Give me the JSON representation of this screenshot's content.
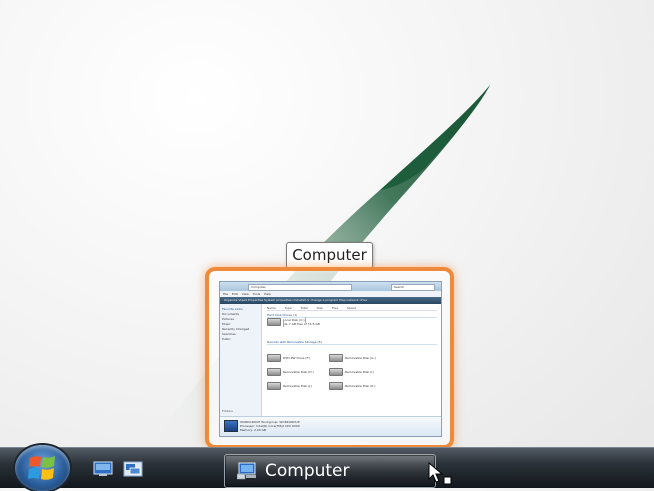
{
  "tooltip": {
    "title": "Computer"
  },
  "thumbnail": {
    "title_bar": "Computer",
    "address": "Computer",
    "search": "Search",
    "menu": "File  Edit  View  Tools  Help",
    "command_bar": "Organize  Views  Properties  System properties  Uninstall or change a program  Map network drive",
    "nav_header": "Favorite Links",
    "nav_items": [
      "Documents",
      "Pictures",
      "Music",
      "Recently Changed",
      "Searches",
      "Public"
    ],
    "nav_folders": "Folders",
    "columns": "Name  Type  Total Size  Free Space",
    "group_hdd": "Hard Disk Drives (1)",
    "drive_c": {
      "label": "Local Disk (C:)",
      "used_fraction": 0.55,
      "free": "41.7 GB free of 74.5 GB"
    },
    "group_removable": "Devices with Removable Storage (6)",
    "drives": [
      "DVD RW Drive (F:)",
      "Removable Disk (G:)",
      "Removable Disk (H:)",
      "Removable Disk (I:)",
      "Removable Disk (J:)",
      "Removable Disk (K:)"
    ],
    "status": [
      "WORKGROUP  Workgroup: WORKGROUP",
      "Processor: Intel(R) Core(TM)2 CPU 6300",
      "Memory: 2.00 GB"
    ]
  },
  "taskbar": {
    "task_label": "Computer"
  },
  "colors": {
    "thumbnail_highlight": "#ef8a3a",
    "taskbar": "#2a3138"
  },
  "icons": [
    "windows-logo-icon",
    "show-desktop-icon",
    "switch-windows-icon",
    "computer-icon",
    "mouse-cursor-icon"
  ]
}
